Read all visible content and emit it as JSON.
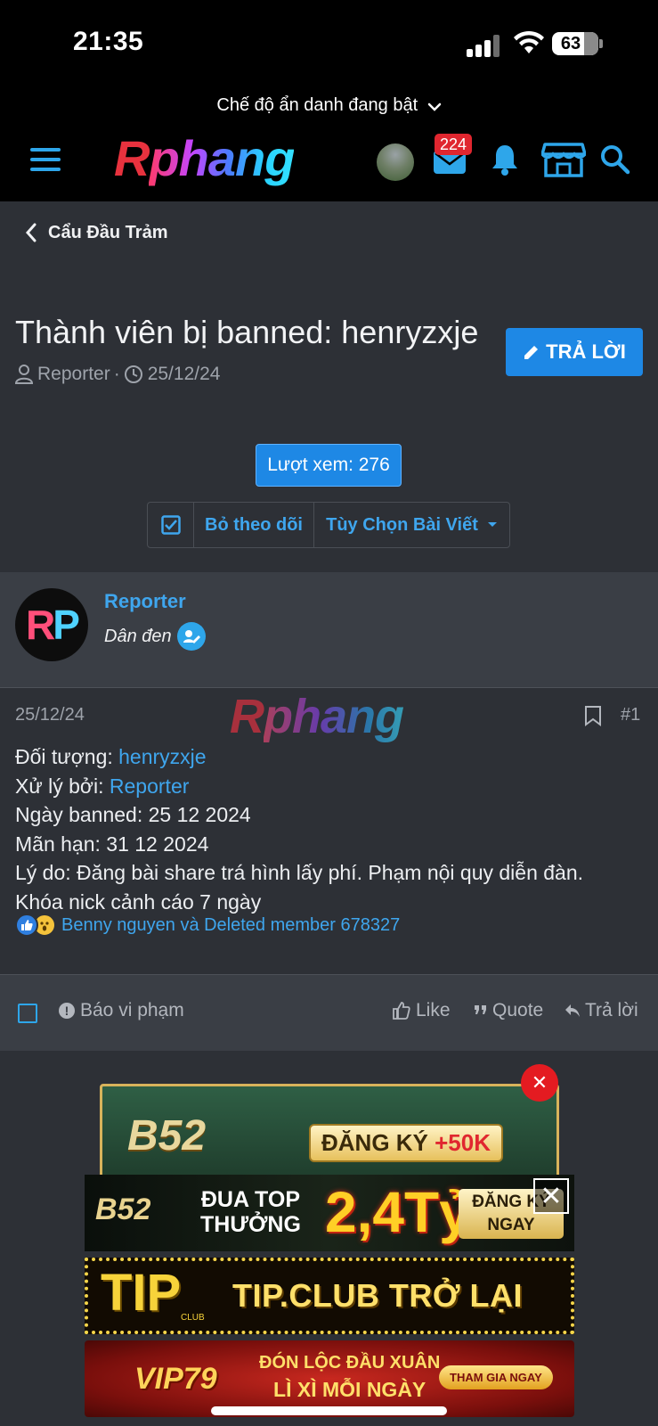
{
  "status_bar": {
    "time": "21:35",
    "battery": "63"
  },
  "incognito": {
    "label": "Chế độ ẩn danh đang bật"
  },
  "header": {
    "logo_r": "R",
    "logo_rest": "phang",
    "mail_badge": "224"
  },
  "breadcrumb": {
    "label": "Cẩu Đầu Trảm"
  },
  "thread": {
    "title": "Thành viên bị banned: henryzxje",
    "reply_button": "TRẢ LỜI",
    "author": "Reporter",
    "date": "25/12/24",
    "views": "Lượt xem: 276",
    "unfollow": "Bỏ theo dõi",
    "options": "Tùy Chọn Bài Viết"
  },
  "post": {
    "avatar_initials_1": "R",
    "avatar_initials_2": "P",
    "author": "Reporter",
    "author_title": "Dân đen",
    "date": "25/12/24",
    "watermark_r": "R",
    "watermark_rest": "phang",
    "number": "#1",
    "lines": {
      "target_label": "Đối tượng: ",
      "target_value": "henryzxje",
      "handled_label": "Xử lý bởi: ",
      "handled_value": "Reporter",
      "banned_date": "Ngày banned: 25 12 2024",
      "expiry": "Mãn hạn: 31 12 2024",
      "reason": "Lý do: Đăng bài share trá hình lấy phí. Phạm nội quy diễn đàn.",
      "penalty": "Khóa nick cảnh cáo 7 ngày"
    },
    "reactions_text": "Benny nguyen và Deleted member 678327"
  },
  "footer": {
    "report": "Báo vi phạm",
    "like": "Like",
    "quote": "Quote",
    "reply": "Trả lời"
  },
  "ads": {
    "top": {
      "brand": "B52",
      "cta_prefix": "ĐĂNG KÝ ",
      "cta_amount": "+50K"
    },
    "banner1": {
      "brand": "B52",
      "line1": "ĐUA TOP",
      "line2": "THƯỞNG",
      "amount": "2,4Tỷ",
      "cta1": "ĐĂNG KÝ",
      "cta2": "NGAY"
    },
    "banner2": {
      "brand": "TIP",
      "sub": "CLUB",
      "text": "TIP.CLUB TRỞ LẠI"
    },
    "banner3": {
      "brand": "VIP79",
      "line1": "ĐÓN LỘC ĐẦU XUÂN",
      "line2": "LÌ XÌ MỖI NGÀY",
      "cta": "THAM GIA NGAY"
    }
  },
  "colors": {
    "accent": "#1e88e5",
    "link": "#3fa6ee",
    "background": "#2d3036",
    "panel": "#3a3e45",
    "badge_red": "#e0262f"
  }
}
